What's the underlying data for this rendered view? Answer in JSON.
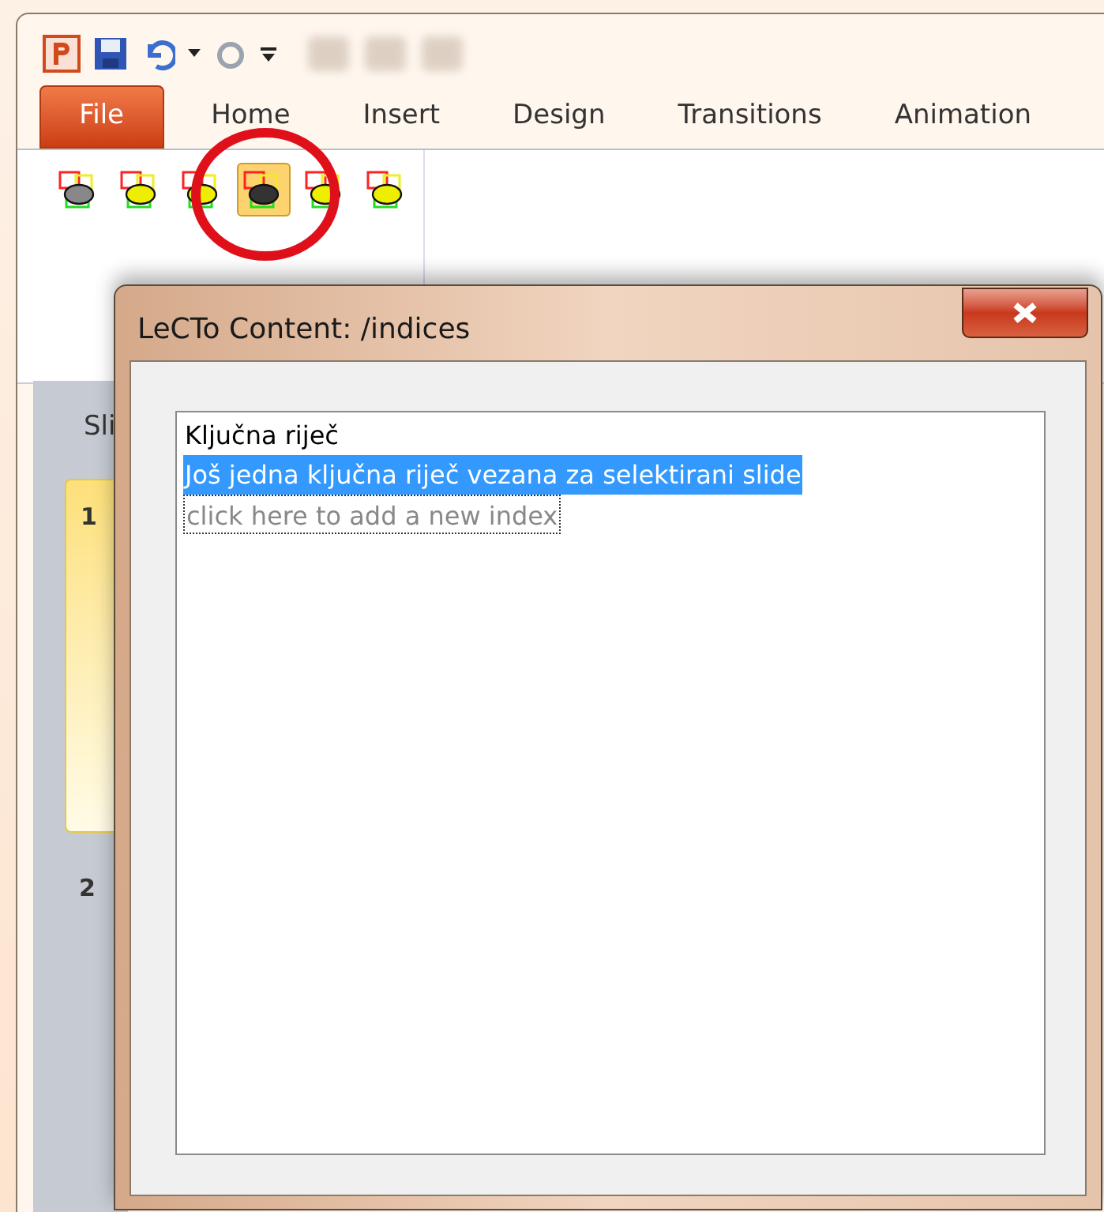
{
  "tabs": [
    {
      "label": "File",
      "kind": "file"
    },
    {
      "label": "Home",
      "kind": "tab"
    },
    {
      "label": "Insert",
      "kind": "tab"
    },
    {
      "label": "Design",
      "kind": "tab"
    },
    {
      "label": "Transitions",
      "kind": "tab"
    },
    {
      "label": "Animation",
      "kind": "tab"
    }
  ],
  "ribbon_buttons": [
    {
      "selected": false
    },
    {
      "selected": false
    },
    {
      "selected": false
    },
    {
      "selected": true
    },
    {
      "selected": false
    },
    {
      "selected": false
    }
  ],
  "pane_tab": "Sli",
  "slides": [
    {
      "number": "1",
      "selected": true
    },
    {
      "number": "2",
      "selected": false
    }
  ],
  "dialog": {
    "title": "LeCTo Content: /indices",
    "items": [
      {
        "text": "Ključna riječ",
        "kind": "entry",
        "selected": false
      },
      {
        "text": "Još jedna ključna riječ vezana za selektirani slide",
        "kind": "entry",
        "selected": true
      },
      {
        "text": "click here to add a new index",
        "kind": "placeholder",
        "selected": false
      }
    ]
  }
}
